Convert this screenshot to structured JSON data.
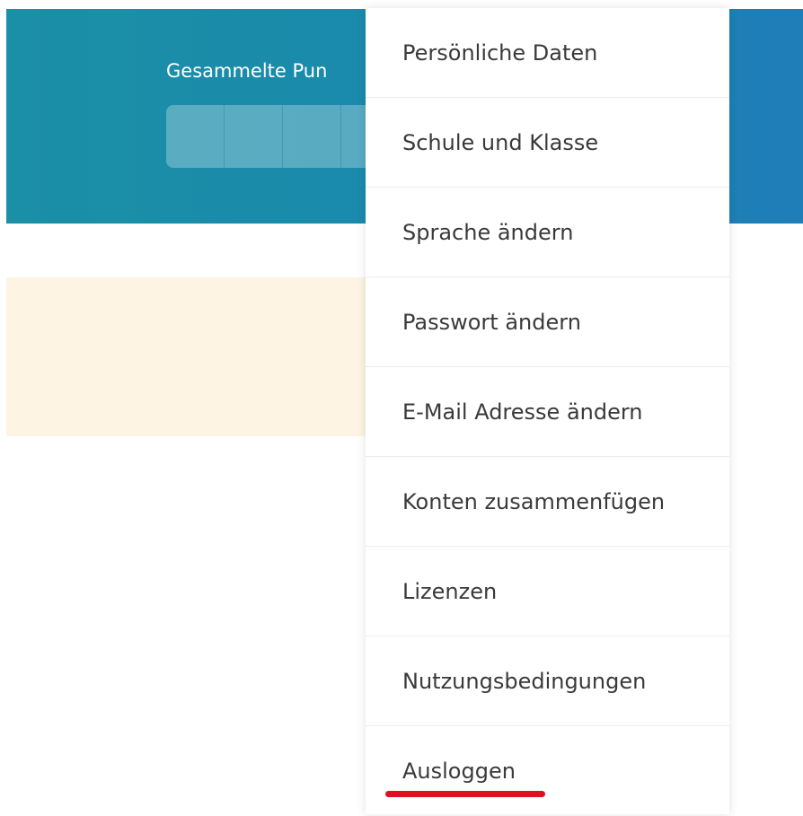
{
  "banner": {
    "title": "Gesammelte Pun",
    "points_segments": 4
  },
  "menu": {
    "items": [
      {
        "label": "Persönliche Daten"
      },
      {
        "label": "Schule und Klasse"
      },
      {
        "label": "Sprache ändern"
      },
      {
        "label": "Passwort ändern"
      },
      {
        "label": "E-Mail Adresse ändern"
      },
      {
        "label": "Konten zusammenfügen"
      },
      {
        "label": "Lizenzen"
      },
      {
        "label": "Nutzungsbedingungen"
      },
      {
        "label": "Ausloggen"
      }
    ]
  },
  "colors": {
    "banner": "#1b8fa6",
    "notice_bg": "#fdf4e3",
    "highlight": "#e01020",
    "menu_text": "#3a3a3a"
  }
}
